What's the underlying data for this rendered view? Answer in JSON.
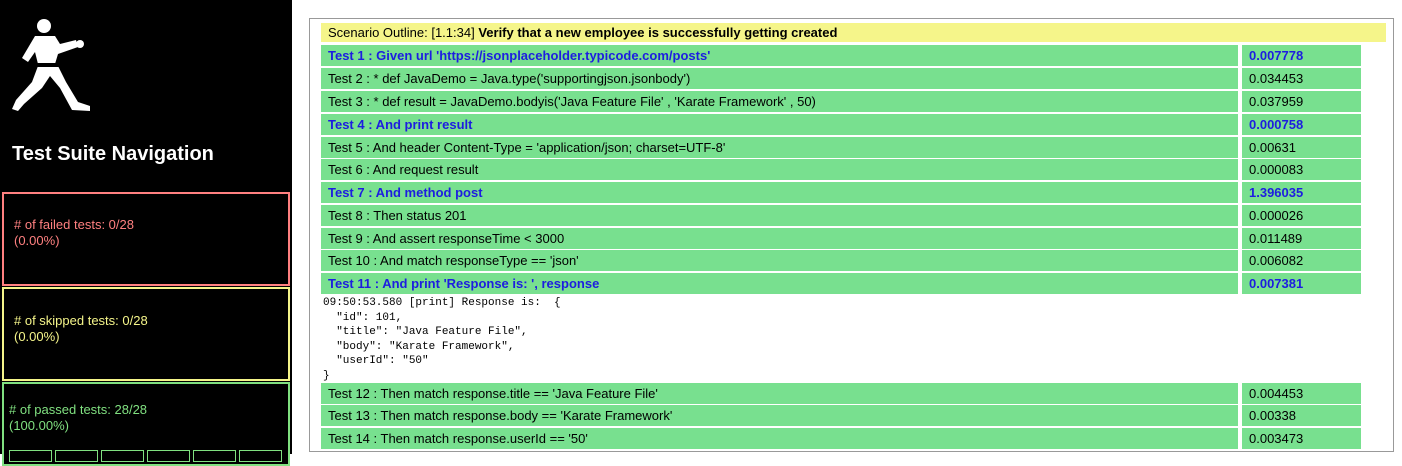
{
  "sidebar": {
    "logo_icon": "karate-fighter-icon",
    "title": "Test Suite Navigation",
    "failed": {
      "label": "# of failed tests: 0/28",
      "percent": "(0.00%)",
      "color": "#ff8080"
    },
    "skipped": {
      "label": "# of skipped tests: 0/28",
      "percent": "(0.00%)",
      "color": "#f5f58a"
    },
    "passed": {
      "label": "# of passed tests: 28/28",
      "percent": "(100.00%)",
      "color": "#80e080"
    }
  },
  "scenario": {
    "prefix": "Scenario Outline: [1.1:34]",
    "title": "Verify that a new employee is successfully getting created"
  },
  "steps": [
    {
      "text": "Test 1 : Given url 'https://jsonplaceholder.typicode.com/posts'",
      "time": "0.007778"
    },
    {
      "text": "Test 2 : * def JavaDemo = Java.type('supportingjson.jsonbody')",
      "time": "0.034453"
    },
    {
      "text": "Test 3 : * def result = JavaDemo.bodyis('Java Feature File' , 'Karate Framework' , 50)",
      "time": "0.037959"
    },
    {
      "text": "Test 4 : And print result",
      "time": "0.000758"
    },
    {
      "text": "Test 5 : And header Content-Type = 'application/json; charset=UTF-8'",
      "time": "0.00631"
    },
    {
      "text": "Test 6 : And request result",
      "time": "0.000083"
    },
    {
      "text": "Test 7 : And method post",
      "time": "1.396035"
    },
    {
      "text": "Test 8 : Then status 201",
      "time": "0.000026"
    },
    {
      "text": "Test 9 : And assert responseTime < 3000",
      "time": "0.011489"
    },
    {
      "text": "Test 10 : And match responseType == 'json'",
      "time": "0.006082"
    },
    {
      "text": "Test 11 : And print 'Response is: ', response",
      "time": "0.007381"
    },
    {
      "text": "Test 12 : Then match response.title == 'Java Feature File'",
      "time": "0.004453"
    },
    {
      "text": "Test 13 : Then match response.body == 'Karate Framework'",
      "time": "0.00338"
    },
    {
      "text": "Test 14 : Then match response.userId == '50'",
      "time": "0.003473"
    }
  ],
  "log": "09:50:53.580 [print] Response is:  {\n  \"id\": 101,\n  \"title\": \"Java Feature File\",\n  \"body\": \"Karate Framework\",\n  \"userId\": \"50\"\n}"
}
